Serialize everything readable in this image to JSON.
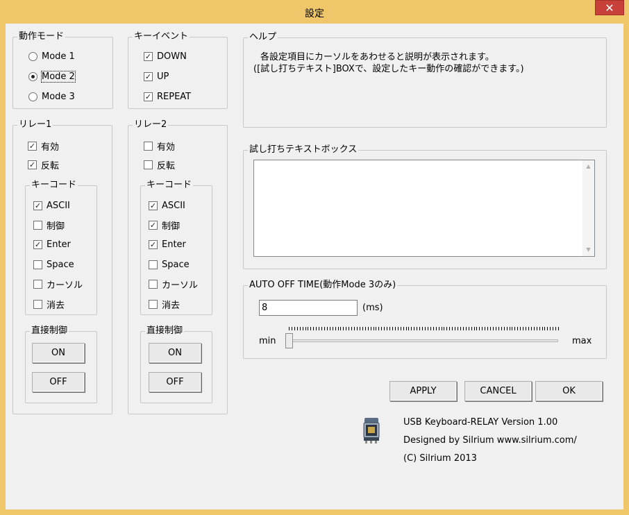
{
  "window": {
    "title": "設定",
    "close_glyph": "✕"
  },
  "mode_group": {
    "label": "動作モード",
    "options": [
      "Mode 1",
      "Mode 2",
      "Mode 3"
    ],
    "selected": "Mode 2"
  },
  "keyevent_group": {
    "label": "キーイベント",
    "items": [
      {
        "label": "DOWN",
        "checked": true
      },
      {
        "label": "UP",
        "checked": true
      },
      {
        "label": "REPEAT",
        "checked": true
      }
    ]
  },
  "relay1": {
    "label": "リレー1",
    "enabled_label": "有効",
    "enabled": true,
    "invert_label": "反転",
    "invert": true,
    "keycode": {
      "label": "キーコード",
      "items": [
        {
          "label": "ASCII",
          "checked": true
        },
        {
          "label": "制御",
          "checked": false
        },
        {
          "label": "Enter",
          "checked": true
        },
        {
          "label": "Space",
          "checked": false
        },
        {
          "label": "カーソル",
          "checked": false
        },
        {
          "label": "消去",
          "checked": false
        }
      ]
    },
    "direct": {
      "label": "直接制御",
      "on_label": "ON",
      "off_label": "OFF"
    }
  },
  "relay2": {
    "label": "リレー2",
    "enabled_label": "有効",
    "enabled": false,
    "invert_label": "反転",
    "invert": false,
    "keycode": {
      "label": "キーコード",
      "items": [
        {
          "label": "ASCII",
          "checked": true
        },
        {
          "label": "制御",
          "checked": true
        },
        {
          "label": "Enter",
          "checked": true
        },
        {
          "label": "Space",
          "checked": false
        },
        {
          "label": "カーソル",
          "checked": false
        },
        {
          "label": "消去",
          "checked": false
        }
      ]
    },
    "direct": {
      "label": "直接制御",
      "on_label": "ON",
      "off_label": "OFF"
    }
  },
  "help": {
    "label": "ヘルプ",
    "line1": "各設定項目にカーソルをあわせると説明が表示されます。",
    "line2": "([試し打ちテキスト]BOXで、設定したキー動作の確認ができます。)"
  },
  "test_box": {
    "label": "試し打ちテキストボックス",
    "value": ""
  },
  "auto_off": {
    "label": "AUTO OFF TIME(動作Mode 3のみ)",
    "value": "8",
    "unit": "(ms)",
    "min_label": "min",
    "max_label": "max",
    "slider_fraction": 0.0
  },
  "buttons": {
    "apply": "APPLY",
    "cancel": "CANCEL",
    "ok": "OK"
  },
  "about": {
    "line1": "USB Keyboard-RELAY Version 1.00",
    "line2": "Designed by Silrium  www.silrium.com/",
    "line3": "(C) Silrium 2013",
    "icon": "relay-icon"
  },
  "colors": {
    "titlebar": "#f0c66a",
    "close": "#c7413a",
    "client": "#f0f0f0"
  }
}
